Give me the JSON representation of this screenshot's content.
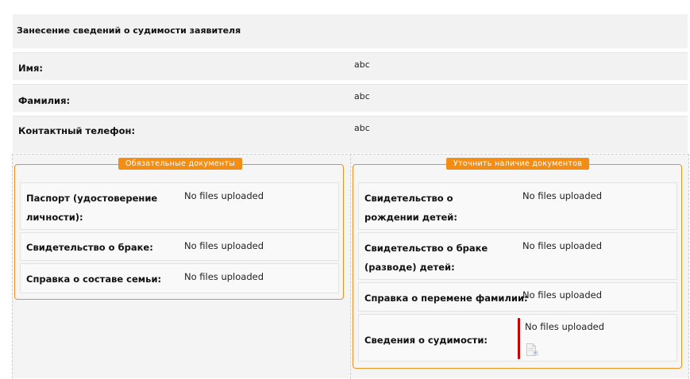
{
  "header": {
    "title": "Занесение сведений о судимости заявителя"
  },
  "applicant": {
    "first_name": {
      "label": "Имя:",
      "value": "abc"
    },
    "last_name": {
      "label": "Фамилия:",
      "value": "abc"
    },
    "phone": {
      "label": "Контактный телефон:",
      "value": "abc"
    }
  },
  "mandatory_docs": {
    "legend": "Обязательные документы",
    "items": [
      {
        "label": "Паспорт (удостоверение личности):",
        "files": "No files uploaded"
      },
      {
        "label": "Свидетельство о браке:",
        "files": "No files uploaded"
      },
      {
        "label": "Справка о составе семьи:",
        "files": "No files uploaded"
      }
    ]
  },
  "optional_docs": {
    "legend": "Уточнить наличие документов",
    "items": [
      {
        "label": "Свидетельство о рождении детей:",
        "files": "No files uploaded"
      },
      {
        "label": "Свидетельство о браке (разводе) детей:",
        "files": "No files uploaded"
      },
      {
        "label": "Справка о перемене фамилии:",
        "files": "No files uploaded"
      },
      {
        "label": "Сведения о судимости:",
        "files": "No files uploaded"
      }
    ]
  },
  "icons": {
    "upload": "upload-file-icon"
  },
  "colors": {
    "accent": "#f38d13",
    "error": "#cc0000"
  }
}
